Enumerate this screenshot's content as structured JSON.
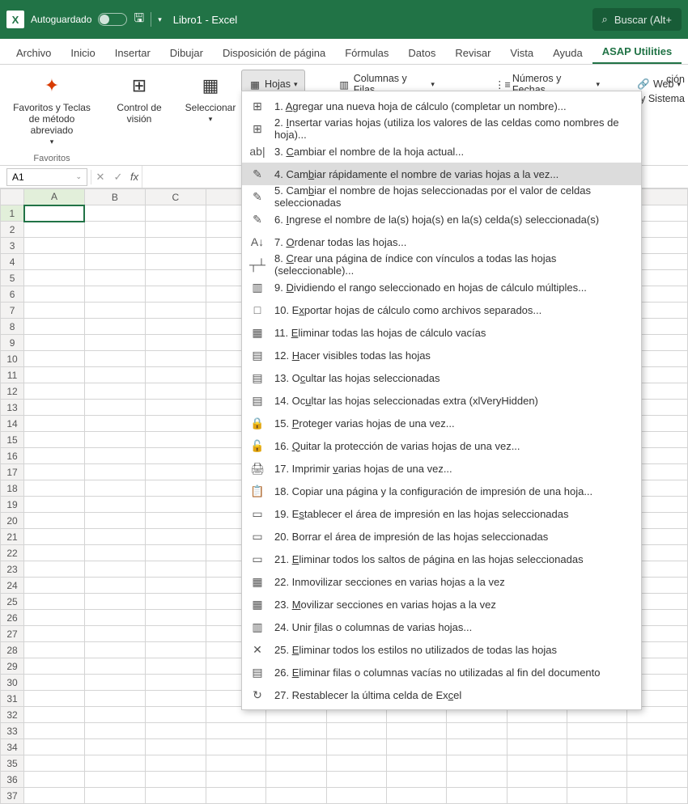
{
  "titlebar": {
    "autosave": "Autoguardado",
    "title": "Libro1  -  Excel",
    "search_placeholder": "Buscar (Alt+"
  },
  "tabs": [
    "Archivo",
    "Inicio",
    "Insertar",
    "Dibujar",
    "Disposición de página",
    "Fórmulas",
    "Datos",
    "Revisar",
    "Vista",
    "Ayuda",
    "ASAP Utilities"
  ],
  "active_tab": "ASAP Utilities",
  "ribbon": {
    "fav_label": "Favoritos y Teclas de método abreviado",
    "fav_group": "Favoritos",
    "control_label": "Control de visión",
    "select_label": "Seleccionar",
    "hojas": "Hojas",
    "columnas": "Columnas y Filas",
    "numeros": "Números y Fechas",
    "web": "Web",
    "cut_right_1": "ción",
    "cut_right_2": "y Sistema"
  },
  "namebox": "A1",
  "columns": [
    "A",
    "B",
    "C"
  ],
  "rows": 37,
  "menu": {
    "highlight_index": 3,
    "items": [
      {
        "icon": "⊞",
        "num": "1.",
        "text": "Agregar una nueva hoja de cálculo (completar un nombre)...",
        "u": 0
      },
      {
        "icon": "⊞",
        "num": "2.",
        "text": "Insertar varias hojas (utiliza los valores de las celdas como nombres de hoja)...",
        "u": 0
      },
      {
        "icon": "ab|",
        "num": "3.",
        "text": "Cambiar el nombre de la hoja actual...",
        "u": 0
      },
      {
        "icon": "✎",
        "num": "4.",
        "text": "Cambiar rápidamente el nombre de varias hojas a la vez...",
        "u": 3
      },
      {
        "icon": "✎",
        "num": "5.",
        "text": "Cambiar el nombre de hojas seleccionadas por el valor de celdas seleccionadas",
        "u": 3
      },
      {
        "icon": "✎",
        "num": "6.",
        "text": "Ingrese el nombre de la(s) hoja(s) en la(s) celda(s) seleccionada(s)",
        "u": 0
      },
      {
        "icon": "A↓",
        "num": "7.",
        "text": "Ordenar todas las hojas...",
        "u": 0
      },
      {
        "icon": "┬┴",
        "num": "8.",
        "text": "Crear una página de índice con vínculos a todas las hojas (seleccionable)...",
        "u": 0
      },
      {
        "icon": "▥",
        "num": "9.",
        "text": "Dividiendo el rango seleccionado en hojas de cálculo múltiples...",
        "u": 0
      },
      {
        "icon": "□",
        "num": "10.",
        "text": "Exportar hojas de cálculo como archivos separados...",
        "u": 1
      },
      {
        "icon": "▦",
        "num": "11.",
        "text": "Eliminar todas las hojas de cálculo vacías",
        "u": 0
      },
      {
        "icon": "▤",
        "num": "12.",
        "text": "Hacer visibles todas las hojas",
        "u": 0
      },
      {
        "icon": "▤",
        "num": "13.",
        "text": "Ocultar las hojas seleccionadas",
        "u": 1
      },
      {
        "icon": "▤",
        "num": "14.",
        "text": "Ocultar las hojas seleccionadas extra (xlVeryHidden)",
        "u": 2
      },
      {
        "icon": "🔒",
        "num": "15.",
        "text": "Proteger varias hojas de una vez...",
        "u": 0
      },
      {
        "icon": "🔓",
        "num": "16.",
        "text": "Quitar la protección de varias hojas de una vez...",
        "u": 0
      },
      {
        "icon": "🖨",
        "num": "17.",
        "text": "Imprimir varias hojas de una vez...",
        "u": 9
      },
      {
        "icon": "📋",
        "num": "18.",
        "text": "Copiar una página y la configuración de impresión de una hoja...",
        "u": -1
      },
      {
        "icon": "▭",
        "num": "19.",
        "text": "Establecer el área de impresión en las hojas seleccionadas",
        "u": 1
      },
      {
        "icon": "▭",
        "num": "20.",
        "text": "Borrar el área de impresión de las hojas seleccionadas",
        "u": -1
      },
      {
        "icon": "▭",
        "num": "21.",
        "text": "Eliminar todos los saltos de página en las hojas seleccionadas",
        "u": 0
      },
      {
        "icon": "▦",
        "num": "22.",
        "text": "Inmovilizar secciones en varias hojas a la vez",
        "u": -1
      },
      {
        "icon": "▦",
        "num": "23.",
        "text": "Movilizar secciones en varias hojas a la vez",
        "u": 0
      },
      {
        "icon": "▥",
        "num": "24.",
        "text": "Unir filas o columnas de varias hojas...",
        "u": 5
      },
      {
        "icon": "✕",
        "num": "25.",
        "text": "Eliminar todos los estilos no utilizados de todas las hojas",
        "u": 0
      },
      {
        "icon": "▤",
        "num": "26.",
        "text": "Eliminar filas o columnas vacías no utilizadas al fin del documento",
        "u": 0
      },
      {
        "icon": "↻",
        "num": "27.",
        "text": "Restablecer la última celda de Excel",
        "u": 33
      }
    ]
  }
}
